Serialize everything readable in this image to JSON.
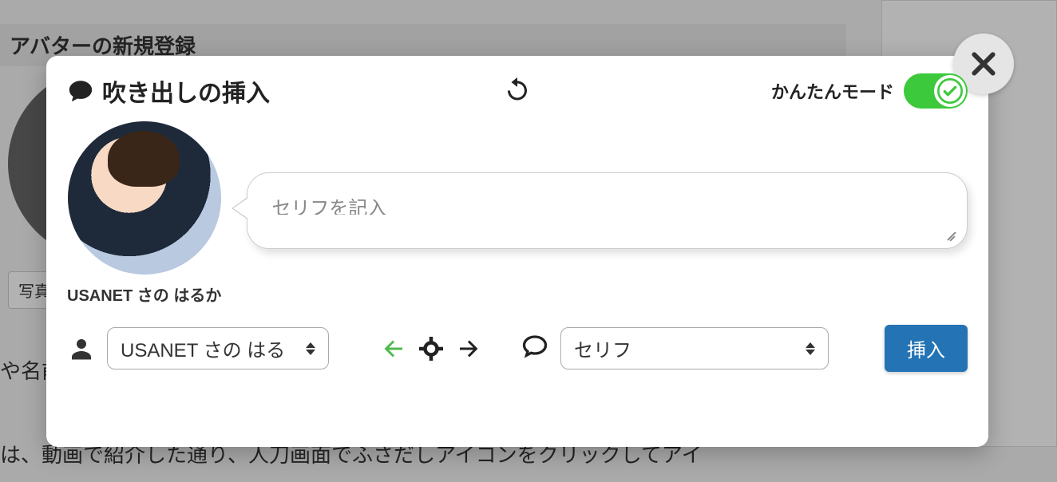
{
  "background": {
    "header_title": "アバターの新規登録",
    "photo_button": "写真",
    "text_line1": "や名前",
    "text_line2": "は、動画で紹介した通り、人刀画面でふさだしアイコンをクリックしてアイ"
  },
  "modal": {
    "title": "吹き出しの挿入",
    "mode_label": "かんたんモード",
    "avatar_name": "USANET さの はるか",
    "bubble": {
      "placeholder": "セリフを記入"
    },
    "controls": {
      "avatar_select_value": "USANET さの はる",
      "type_select_value": "セリフ",
      "insert_button": "挿入"
    }
  }
}
